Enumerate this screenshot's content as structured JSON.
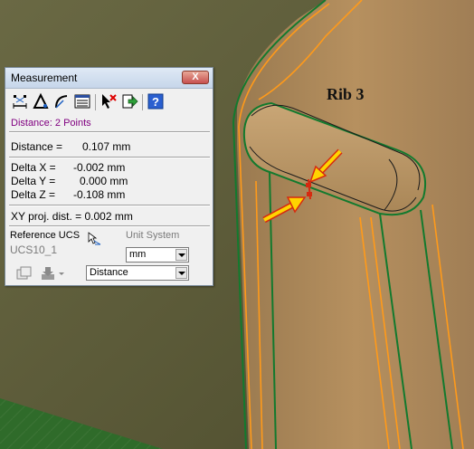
{
  "viewport": {
    "annotation": "Rib 3"
  },
  "dialog": {
    "title": "Measurement",
    "close_label": "X",
    "mode": "Distance:  2 Points",
    "distance_label": "Distance =",
    "distance_value": "0.107 mm",
    "delta_x_label": "Delta X =",
    "delta_x_value": "-0.002 mm",
    "delta_y_label": "Delta Y =",
    "delta_y_value": "0.000 mm",
    "delta_z_label": "Delta Z =",
    "delta_z_value": "-0.108 mm",
    "xy_proj": "XY proj. dist. = 0.002 mm",
    "reference_ucs_label": "Reference UCS",
    "reference_ucs_value": "UCS10_1",
    "unit_system_label": "Unit System",
    "unit_value": "mm",
    "measure_type_value": "Distance"
  },
  "toolbar": {
    "icons": [
      "point-to-point-icon",
      "triangle-measure-icon",
      "arc-measure-icon",
      "list-icon",
      "clear-selection-icon",
      "export-icon",
      "help-icon"
    ]
  },
  "colors": {
    "accent_mode_text": "#800080",
    "part_fill": "#b08a5c",
    "edge_orange": "#ff9a1a",
    "edge_green": "#127a2e",
    "arrow_yellow": "#ffd400",
    "arrow_red": "#d62a10"
  }
}
